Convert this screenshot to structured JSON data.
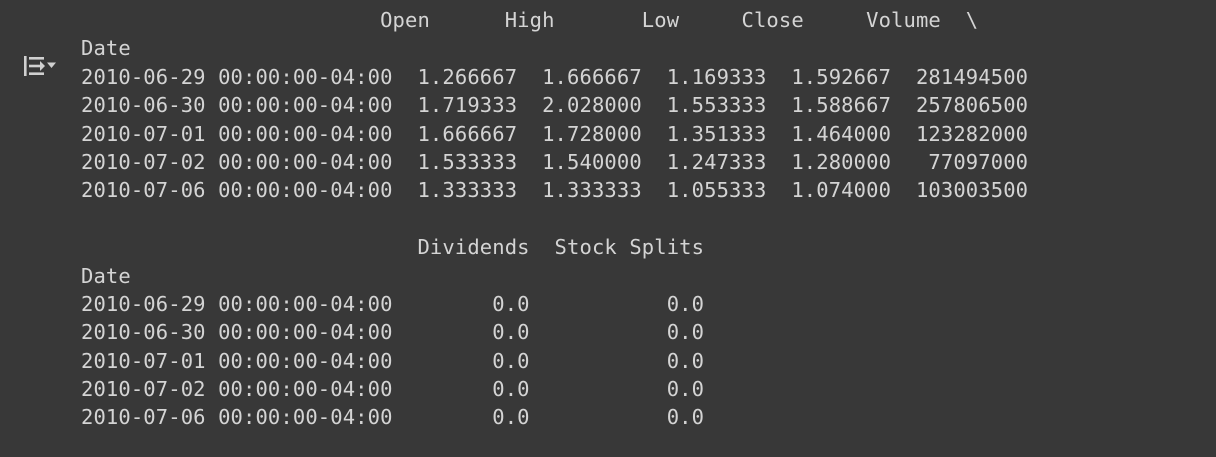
{
  "output": {
    "toggle_icon": "output-collapse-icon",
    "lines": [
      "                        Open      High       Low     Close     Volume  \\",
      "Date",
      "2010-06-29 00:00:00-04:00  1.266667  1.666667  1.169333  1.592667  281494500",
      "2010-06-30 00:00:00-04:00  1.719333  2.028000  1.553333  1.588667  257806500",
      "2010-07-01 00:00:00-04:00  1.666667  1.728000  1.351333  1.464000  123282000",
      "2010-07-02 00:00:00-04:00  1.533333  1.540000  1.247333  1.280000   77097000",
      "2010-07-06 00:00:00-04:00  1.333333  1.333333  1.055333  1.074000  103003500",
      "",
      "                           Dividends  Stock Splits",
      "Date",
      "2010-06-29 00:00:00-04:00        0.0           0.0",
      "2010-06-30 00:00:00-04:00        0.0           0.0",
      "2010-07-01 00:00:00-04:00        0.0           0.0",
      "2010-07-02 00:00:00-04:00        0.0           0.0",
      "2010-07-06 00:00:00-04:00        0.0           0.0"
    ]
  },
  "colors": {
    "background": "#383838",
    "text": "#d4d4d4",
    "icon": "#d0d0d0"
  }
}
